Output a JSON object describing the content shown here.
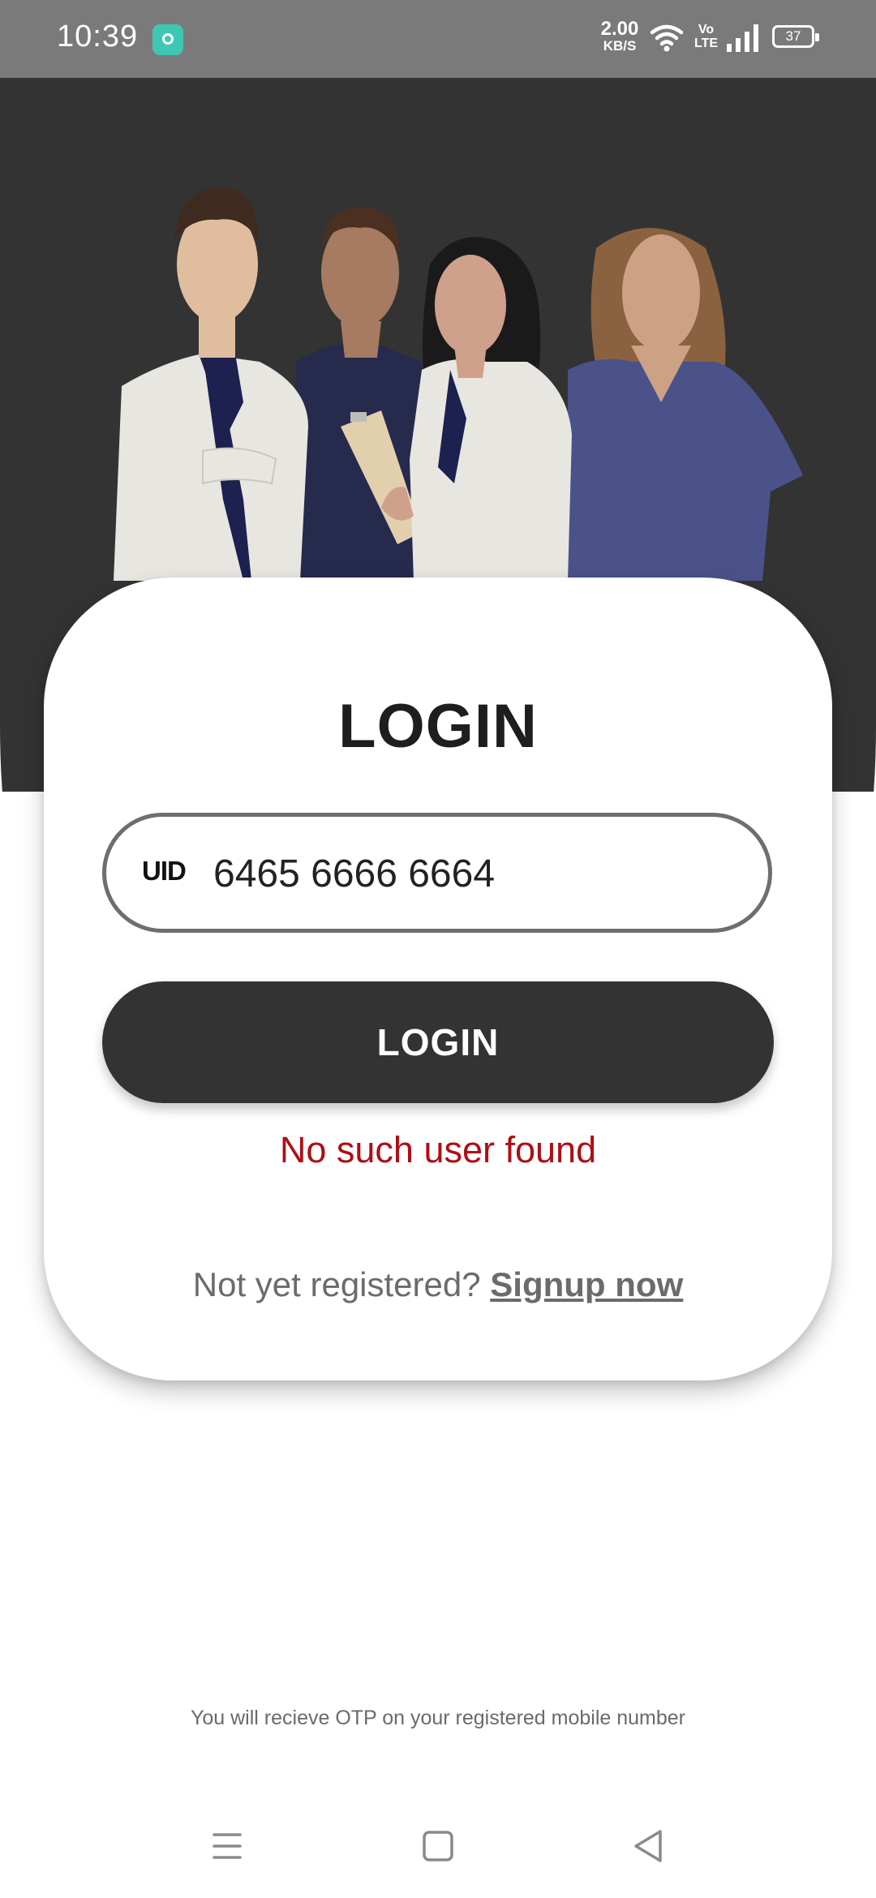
{
  "status_bar": {
    "time": "10:39",
    "app_icon": "camera-app-icon",
    "net_speed_value": "2.00",
    "net_speed_unit": "KB/S",
    "volte_top": "Vo",
    "volte_bottom": "LTE",
    "battery": "37"
  },
  "hero": {
    "illustration": "four-doctors-illustration"
  },
  "login": {
    "title": "LOGIN",
    "uid_label": "UID",
    "uid_value": "6465 6666 6664",
    "button_label": "LOGIN",
    "error_message": "No such user found",
    "signup_prompt": "Not yet registered?",
    "signup_link": "Signup now"
  },
  "footer": {
    "otp_note": "You will recieve OTP on your registered mobile number"
  },
  "navbar": {
    "icons": [
      "menu-icon",
      "home-icon",
      "back-icon"
    ]
  },
  "colors": {
    "status_bar": "#7a7a7a",
    "hero_background": "#333333",
    "button": "#333333",
    "error": "#b00d14",
    "text_muted": "#6b6b6b"
  }
}
